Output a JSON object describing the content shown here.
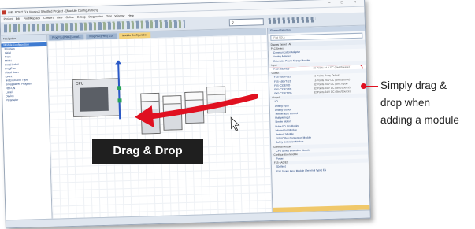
{
  "window": {
    "title": "MELSOFT GX Works3 [Untitled Project - [Module Configuration]]",
    "controls": "–  □  ×"
  },
  "menubar": [
    "Project",
    "Edit",
    "Find/Replace",
    "Convert",
    "View",
    "Online",
    "Debug",
    "Diagnostics",
    "Tool",
    "Window",
    "Help"
  ],
  "toolbar": {
    "combo_value": "Q"
  },
  "navigation": {
    "header": "Navigation",
    "selected": "Module Configuration",
    "items": [
      "Program",
      "Initial",
      "Scan",
      "MAIN",
      "Local Label",
      "ProgPou",
      "Fixed Scan",
      "Event",
      "No Execution Type",
      "Unregistered Program",
      "FB/FUN",
      "Label",
      "Device",
      "Parameter"
    ]
  },
  "tabs": [
    {
      "label": "ProgPou [PRG] [Local...",
      "active": false
    },
    {
      "label": "ProgPou [PRG] [LD]",
      "active": false
    },
    {
      "label": "Module Configuration",
      "active": true
    }
  ],
  "canvas": {
    "cpu_label": "CPU"
  },
  "element_selection": {
    "title": "Element Selection",
    "search_placeholder": "(Find POU)",
    "display_target_label": "Display Target",
    "display_target_value": "All",
    "rows": [
      {
        "label": "PLC Series",
        "desc": "",
        "category": true
      },
      {
        "label": "Communication Adapter",
        "desc": "",
        "category": false
      },
      {
        "label": "Analog Adapter",
        "desc": "",
        "category": false
      },
      {
        "label": "Extension Power Supply Module",
        "desc": "",
        "category": false
      },
      {
        "label": "Input",
        "desc": "",
        "category": true
      },
      {
        "label": "FX5-16EX/ES",
        "desc": "16 Points 24 V DC (Sink/Source)",
        "category": false,
        "highlight": true
      },
      {
        "label": "Output",
        "desc": "",
        "category": true
      },
      {
        "label": "FX5-16EYR/ES",
        "desc": "16 Points Relay Output",
        "category": false
      },
      {
        "label": "FX5-16EYT/ES",
        "desc": "16 Points 24 V DC (Sink/Source)",
        "category": false
      },
      {
        "label": "FX5-C32EX/D",
        "desc": "32 Points 24 V DC (Sink Input)",
        "category": false
      },
      {
        "label": "FX5-C32EYT/D",
        "desc": "32 Points 24 V DC (Sink/Source)",
        "category": false
      },
      {
        "label": "FX5-C32ET/DS",
        "desc": "32 Points 24 V DC (Sink/Source)",
        "category": false
      },
      {
        "label": "Output",
        "desc": "",
        "category": true
      },
      {
        "label": "I/O",
        "desc": "",
        "category": false
      },
      {
        "label": "Analog Input",
        "desc": "",
        "category": false
      },
      {
        "label": "Analog Output",
        "desc": "",
        "category": false
      },
      {
        "label": "Temperature Control",
        "desc": "",
        "category": false
      },
      {
        "label": "Multiple Input",
        "desc": "",
        "category": false
      },
      {
        "label": "Simple Motion",
        "desc": "",
        "category": false
      },
      {
        "label": "Pulse I/O, Positioning",
        "desc": "",
        "category": false
      },
      {
        "label": "Information Module",
        "desc": "",
        "category": false
      },
      {
        "label": "Network Module",
        "desc": "",
        "category": false
      },
      {
        "label": "FX5UC Bus Conversion Module",
        "desc": "",
        "category": false
      },
      {
        "label": "Safety Extension Module",
        "desc": "",
        "category": false
      },
      {
        "label": "General Module",
        "desc": "",
        "category": true
      },
      {
        "label": "CPU Series Extension Module",
        "desc": "",
        "category": false
      },
      {
        "label": "Configuration Module",
        "desc": "",
        "category": true
      },
      {
        "label": "Power",
        "desc": "",
        "category": false
      },
      {
        "label": "FX5-4AD/ES",
        "desc": "",
        "category": true
      },
      {
        "label": "[Outline]",
        "desc": "",
        "category": false
      },
      {
        "label": "FX5 Series Input Module (Terminal Type) ES",
        "desc": "",
        "category": false
      }
    ]
  },
  "overlays": {
    "drag_drop_label": "Drag & Drop",
    "callout_line1": "Simply drag &",
    "callout_line2": "drop when",
    "callout_line3": "adding a module"
  },
  "colors": {
    "arrow": "#e01020",
    "callout_marker": "#e01020",
    "label_box": "#1f1f1f"
  }
}
